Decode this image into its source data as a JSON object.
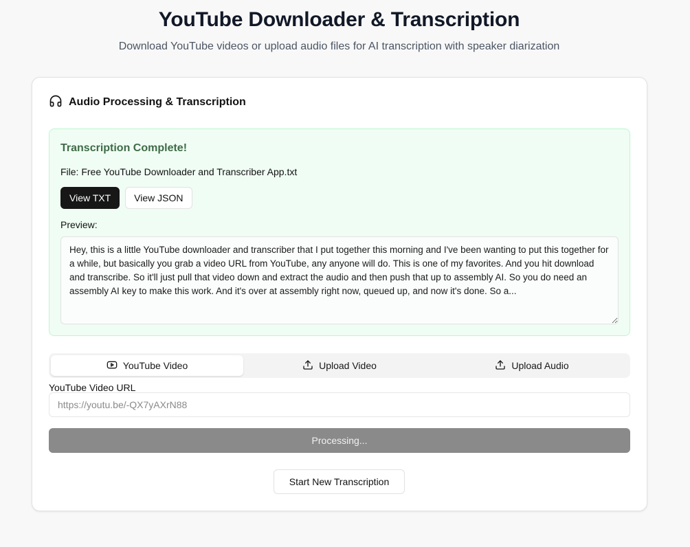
{
  "header": {
    "title": "YouTube Downloader & Transcription",
    "subtitle": "Download YouTube videos or upload audio files for AI transcription with speaker diarization"
  },
  "card": {
    "title": "Audio Processing & Transcription",
    "icon": "headphones-icon"
  },
  "result": {
    "title": "Transcription Complete!",
    "file_line": "File: Free YouTube Downloader and Transcriber App.txt",
    "view_txt_label": "View TXT",
    "view_json_label": "View JSON",
    "preview_label": "Preview:",
    "preview_text": "Hey, this is a little YouTube downloader and transcriber that I put together this morning and I've been wanting to put this together for a while, but basically you grab a video URL from YouTube, any anyone will do. This is one of my favorites. And you hit download and transcribe. So it'll just pull that video down and extract the audio and then push that up to assembly AI. So you do need an assembly AI key to make this work. And it's over at assembly right now, queued up, and now it's done. So a..."
  },
  "tabs": [
    {
      "label": "YouTube Video",
      "icon": "youtube-icon",
      "active": true
    },
    {
      "label": "Upload Video",
      "icon": "upload-icon",
      "active": false
    },
    {
      "label": "Upload Audio",
      "icon": "upload-icon",
      "active": false
    }
  ],
  "form": {
    "url_label": "YouTube Video URL",
    "url_placeholder": "https://youtu.be/-QX7yAXrN88",
    "url_value": "",
    "processing_label": "Processing...",
    "new_transcription_label": "Start New Transcription"
  },
  "colors": {
    "success_bg": "#f0fdf4",
    "success_border": "#bbf7d0",
    "success_title": "#3f6b47",
    "primary_button": "#171717",
    "disabled_button": "#8a8a8a"
  }
}
